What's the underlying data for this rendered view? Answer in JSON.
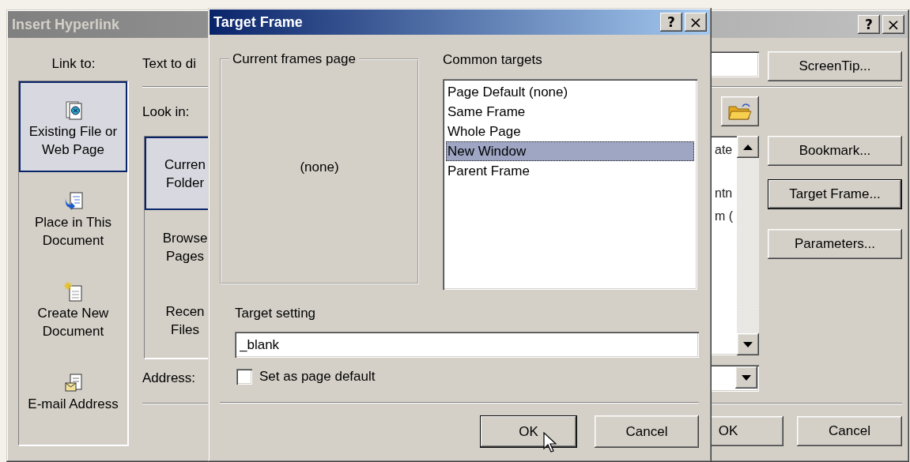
{
  "insert_hyperlink_dialog": {
    "title": "Insert Hyperlink",
    "title_buttons": [
      {
        "kind": "help",
        "label": "?"
      },
      {
        "kind": "close",
        "label": "×"
      }
    ],
    "link_to_label": "Link to:",
    "link_to": [
      {
        "kind": "web_page",
        "label": "Existing File or Web Page",
        "selected": true
      },
      {
        "kind": "place",
        "label": "Place in This Document",
        "selected": false
      },
      {
        "kind": "new_document",
        "label": "Create New Document",
        "selected": false
      },
      {
        "kind": "email",
        "label": "E-mail Address",
        "selected": false
      }
    ],
    "text_to_display_label": "Text to di",
    "look_in_label": "Look in:",
    "look_in_places": [
      {
        "label": "Curren Folder",
        "selected": true
      },
      {
        "label": "Browse Pages",
        "selected": false
      },
      {
        "label": "Recen Files",
        "selected": false
      }
    ],
    "address_label": "Address:",
    "file_list_fragments": [
      "ate",
      "ntn",
      "m ("
    ],
    "side_buttons": [
      {
        "label": "ScreenTip...",
        "default": false
      },
      {
        "label": "Bookmark...",
        "default": false
      },
      {
        "label": "Target Frame...",
        "default": true
      },
      {
        "label": "Parameters...",
        "default": false
      }
    ],
    "buttons": [
      {
        "label": "OK",
        "default": false
      },
      {
        "label": "Cancel",
        "default": false
      }
    ]
  },
  "target_frame_dialog": {
    "title": "Target Frame",
    "title_buttons": [
      {
        "kind": "help",
        "label": "?"
      },
      {
        "kind": "close",
        "label": "×"
      }
    ],
    "frames_group": {
      "label": "Current frames page",
      "content": "(none)"
    },
    "common_targets_label": "Common targets",
    "common_targets": [
      {
        "label": "Page Default (none)",
        "selected": false
      },
      {
        "label": "Same Frame",
        "selected": false
      },
      {
        "label": "Whole Page",
        "selected": false
      },
      {
        "label": "New Window",
        "selected": true
      },
      {
        "label": "Parent Frame",
        "selected": false
      }
    ],
    "target_setting_label": "Target setting",
    "target_setting_value": "_blank",
    "set_as_default": {
      "label": "Set as page default",
      "checked": false
    },
    "buttons": [
      {
        "label": "OK",
        "default": true
      },
      {
        "label": "Cancel",
        "default": false
      }
    ]
  }
}
